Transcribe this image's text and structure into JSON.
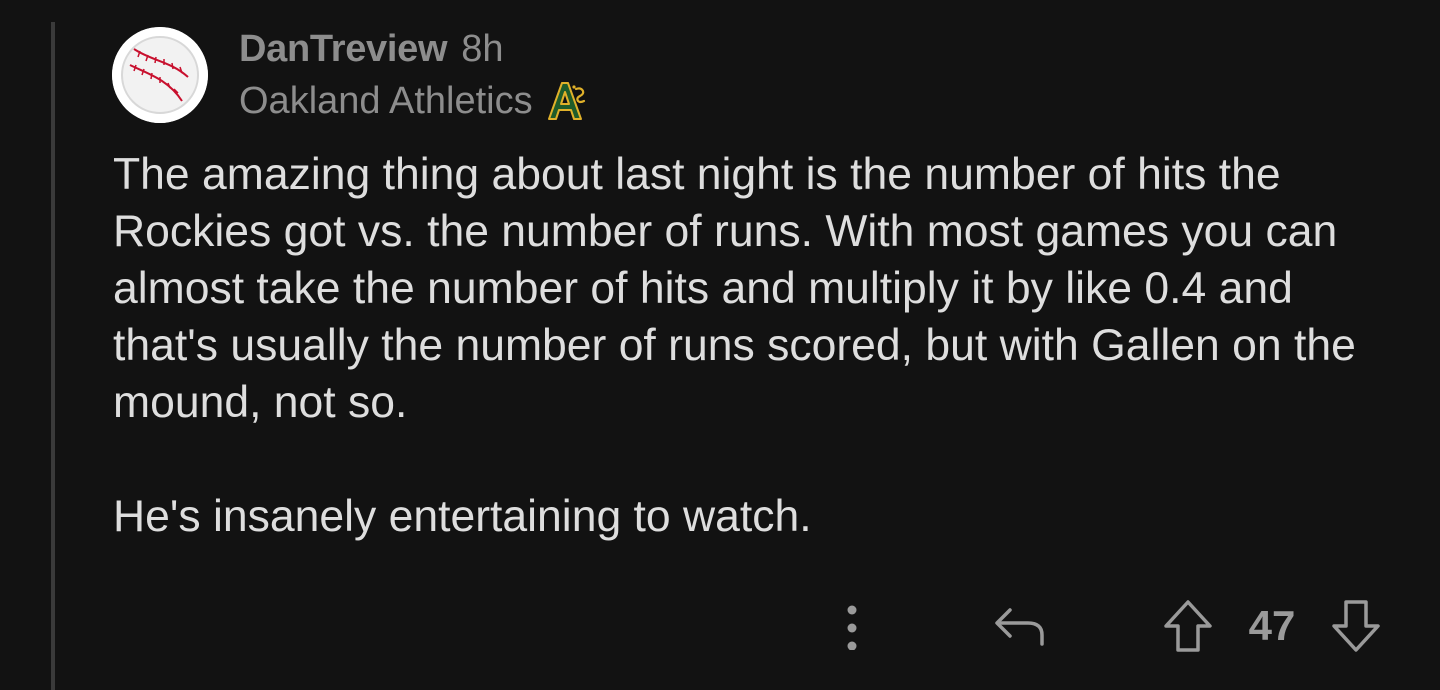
{
  "comment": {
    "author": "DanTreview",
    "age": "8h",
    "flair": "Oakland Athletics",
    "flair_icon": "athletics-logo-icon",
    "avatar_icon": "baseball-avatar-icon",
    "paragraphs": [
      "The amazing thing about last night is the number of hits the Rockies got vs. the number of runs. With most games you can almost take the number of hits and multiply it by like 0.4 and that's usually the number of runs scored, but with Gallen on the mound, not so.",
      "He's insanely entertaining to watch."
    ],
    "score": "47"
  },
  "actions": {
    "more_icon": "more-options-icon",
    "reply_icon": "reply-icon",
    "upvote_icon": "upvote-icon",
    "downvote_icon": "downvote-icon"
  },
  "colors": {
    "background": "#121212",
    "text": "#dedede",
    "muted": "#8d8d8d",
    "thread_line": "#3a3a3a",
    "flair_green": "#1f5c2a",
    "flair_gold": "#e0b12a"
  }
}
